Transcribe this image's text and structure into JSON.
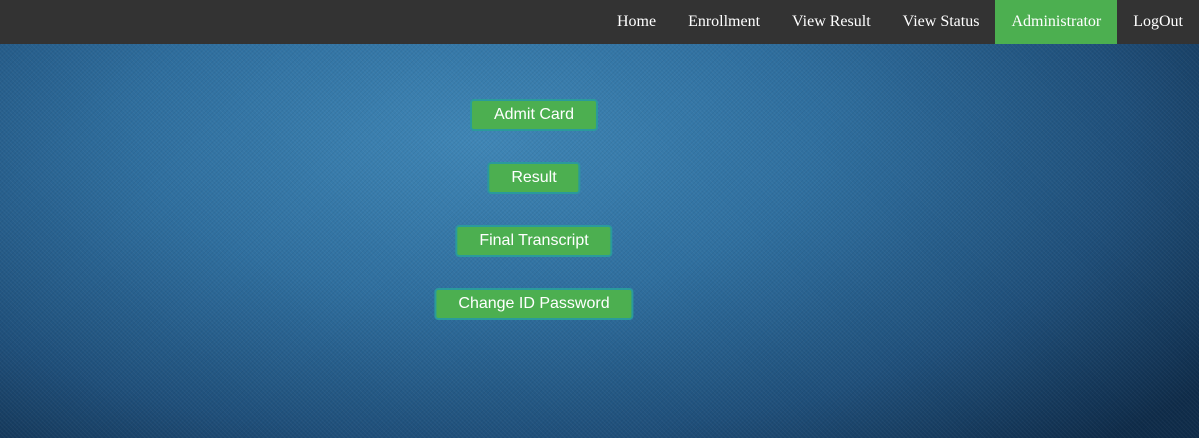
{
  "nav": {
    "items": [
      {
        "label": "Home"
      },
      {
        "label": "Enrollment"
      },
      {
        "label": "View Result"
      },
      {
        "label": "View Status"
      },
      {
        "label": "Administrator"
      },
      {
        "label": "LogOut"
      }
    ],
    "active_label": "Administrator",
    "bar_color": "#333333",
    "active_color": "#4caf50"
  },
  "actions": {
    "admit_card": "Admit Card",
    "result": "Result",
    "final_transcript": "Final Transcript",
    "change_id_password": "Change ID Password",
    "button_color": "#4caf50",
    "button_border_color": "#2a9a9c"
  }
}
